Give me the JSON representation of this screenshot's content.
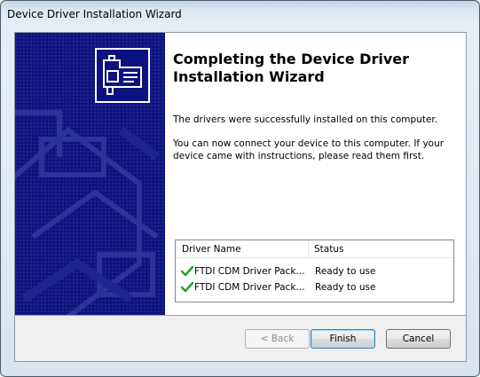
{
  "window": {
    "title": "Device Driver Installation Wizard"
  },
  "banner": {
    "background_color": "#0c127e",
    "logo_icon": "hardware-card-icon"
  },
  "main": {
    "heading": "Completing the Device Driver Installation Wizard",
    "success_text": "The drivers were successfully installed on this computer.",
    "instructions_text": "You can now connect your device to this computer. If your device came with instructions, please read them first."
  },
  "driver_list": {
    "columns": [
      "Driver Name",
      "Status"
    ],
    "rows": [
      {
        "icon": "green-check-icon",
        "name": "FTDI CDM Driver Packa...",
        "status": "Ready to use"
      },
      {
        "icon": "green-check-icon",
        "name": "FTDI CDM Driver Packa...",
        "status": "Ready to use"
      }
    ]
  },
  "buttons": {
    "back": "< Back",
    "finish": "Finish",
    "cancel": "Cancel"
  },
  "colors": {
    "check_green": "#2e9e2e",
    "finish_focus": "#3c7fb1"
  }
}
